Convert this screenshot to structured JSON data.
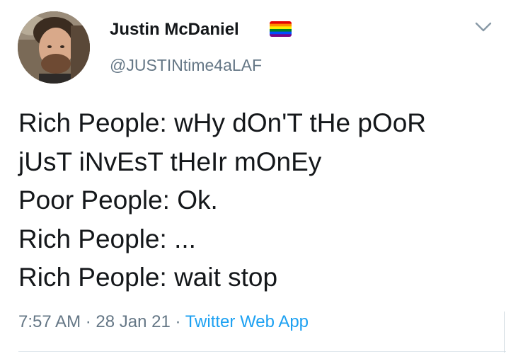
{
  "user": {
    "display_name": "Justin McDaniel",
    "handle": "@JUSTINtime4aLAF",
    "avatar_icon": "profile-photo-avatar",
    "name_badge_icon": "rainbow-flag-icon"
  },
  "tweet": {
    "lines": [
      "Rich People: wHy dOn'T tHe pOoR",
      "jUsT iNvEsT tHeIr mOnEy",
      "Poor People: Ok.",
      "Rich People: ...",
      "Rich People: wait stop"
    ],
    "time": "7:57 AM",
    "separator": " · ",
    "date": "28 Jan 21",
    "source": "Twitter Web App"
  },
  "menu_icon": "chevron-down-icon",
  "colors": {
    "text": "#14171a",
    "secondary": "#657786",
    "link": "#1da1f2",
    "divider": "#e1e8ed"
  }
}
